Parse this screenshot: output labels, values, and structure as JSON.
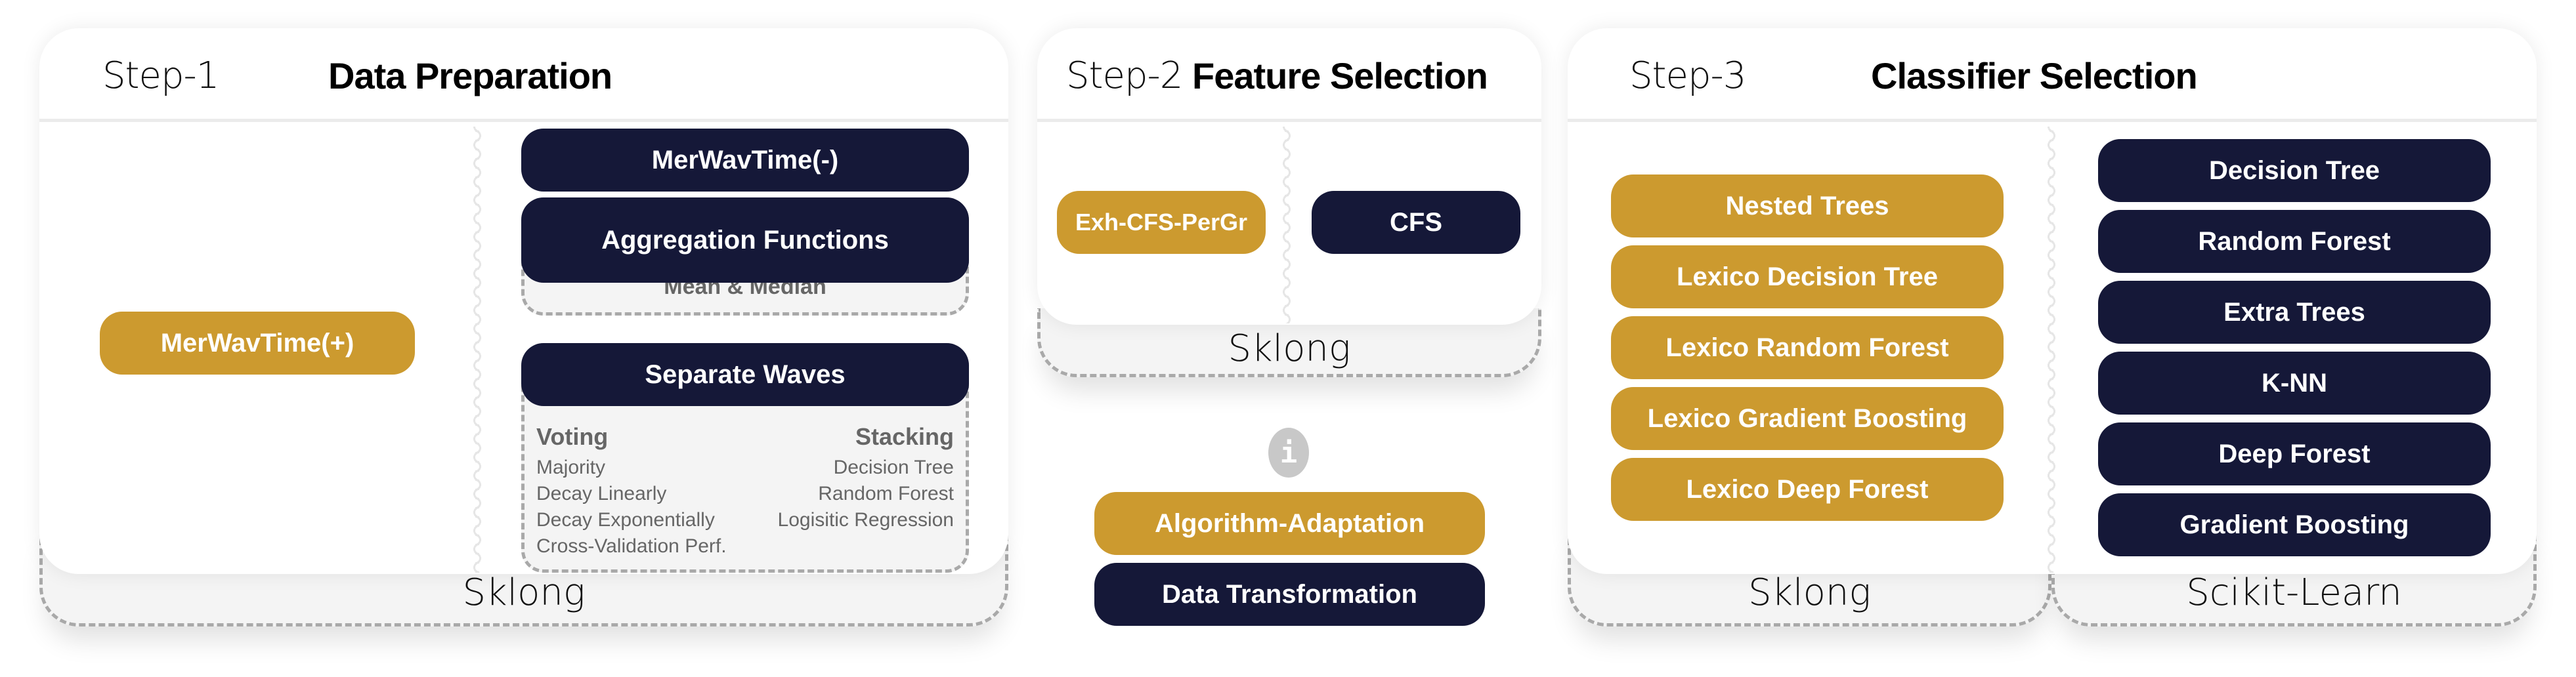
{
  "colors": {
    "gold": "#cc9a2f",
    "navy": "#151838",
    "footer_bg": "#f4f4f4",
    "dashed_border": "#a9a9a9",
    "muted_text": "#666666"
  },
  "step1": {
    "step_label": "Step-1",
    "title": "Data Preparation",
    "footer": "Sklong",
    "left_option": "MerWavTime(+)",
    "right": {
      "merwavtime_minus": "MerWavTime(-)",
      "aggregation": {
        "label": "Aggregation Functions",
        "detail": "Mean & Median"
      },
      "separate_waves": {
        "label": "Separate Waves",
        "voting": {
          "heading": "Voting",
          "items": [
            "Majority",
            "Decay Linearly",
            "Decay Exponentially",
            "Cross-Validation Perf."
          ]
        },
        "stacking": {
          "heading": "Stacking",
          "items": [
            "Decision Tree",
            "Random Forest",
            "Logisitic Regression"
          ]
        }
      }
    }
  },
  "step2": {
    "step_label": "Step-2",
    "title": "Feature Selection",
    "footer": "Sklong",
    "options": [
      "Exh-CFS-PerGr",
      "CFS"
    ]
  },
  "legend": {
    "icon": "info-icon",
    "icon_glyph": "i",
    "items": [
      {
        "label": "Algorithm-Adaptation",
        "color": "gold"
      },
      {
        "label": "Data Transformation",
        "color": "navy"
      }
    ]
  },
  "step3": {
    "step_label": "Step-3",
    "title": "Classifier Selection",
    "footers": [
      "Sklong",
      "Scikit-Learn"
    ],
    "sklong_classifiers": [
      "Nested Trees",
      "Lexico Decision Tree",
      "Lexico Random Forest",
      "Lexico Gradient Boosting",
      "Lexico Deep Forest"
    ],
    "sklearn_classifiers": [
      "Decision Tree",
      "Random Forest",
      "Extra Trees",
      "K-NN",
      "Deep Forest",
      "Gradient Boosting"
    ]
  }
}
